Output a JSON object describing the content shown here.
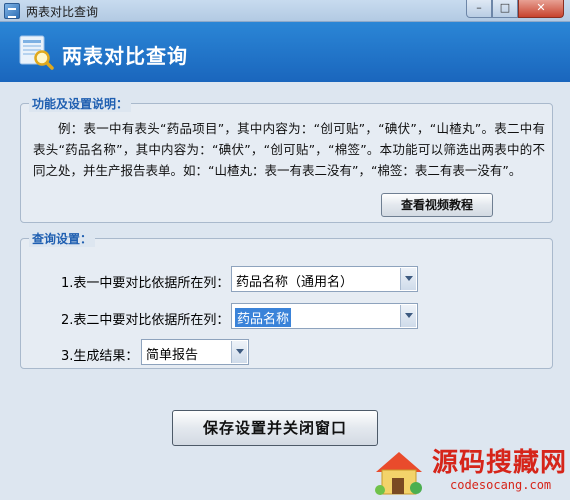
{
  "window": {
    "title": "两表对比查询",
    "controls": {
      "minimize": "–",
      "maximize": "□",
      "close": "✕"
    }
  },
  "header": {
    "title": "两表对比查询",
    "icon": "table-search-icon"
  },
  "info_group": {
    "title": "功能及设置说明：",
    "description": "例：表一中有表头“药品项目”，其中内容为：“创可贴”，“碘伏”，“山楂丸”。表二中有表头“药品名称”，其中内容为：“碘伏”，“创可贴”，“棉签”。本功能可以筛选出两表中的不同之处，并生产报告表单。如：“山楂丸：表一有表二没有”，“棉签：表二有表一没有”。",
    "video_button": "查看视频教程"
  },
  "query_group": {
    "title": "查询设置：",
    "fields": [
      {
        "label": "1.表一中要对比依据所在列：",
        "value": "药品名称（通用名）"
      },
      {
        "label": "2.表二中要对比依据所在列：",
        "value": "药品名称"
      },
      {
        "label": "3.生成结果：",
        "value": "简单报告"
      }
    ]
  },
  "save_button": "保存设置并关闭窗口",
  "watermark": {
    "text": "源码搜藏网",
    "url": "codesocang.com"
  }
}
